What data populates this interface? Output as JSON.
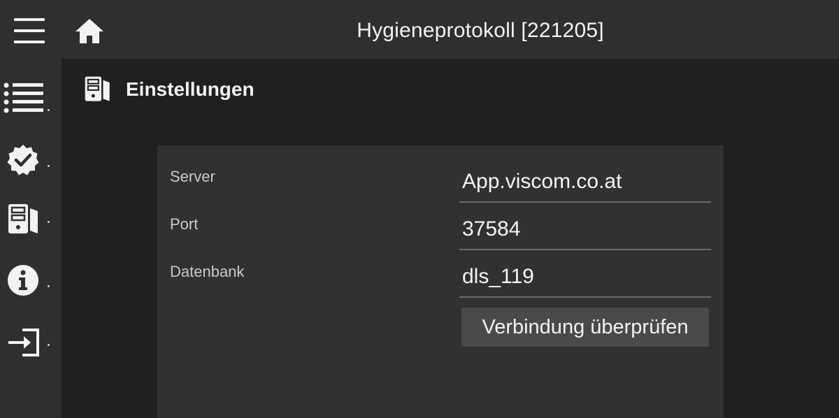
{
  "header": {
    "title": "Hygieneprotokoll [221205]",
    "menu_icon": "menu-icon",
    "home_icon": "home-icon"
  },
  "sidebar": {
    "items": [
      {
        "icon": "list-icon"
      },
      {
        "icon": "check-badge-icon"
      },
      {
        "icon": "server-icon"
      },
      {
        "icon": "info-icon"
      },
      {
        "icon": "login-icon"
      }
    ]
  },
  "page": {
    "title": "Einstellungen",
    "title_icon": "server-icon"
  },
  "settings": {
    "server": {
      "label": "Server",
      "value": "App.viscom.co.at"
    },
    "port": {
      "label": "Port",
      "value": "37584"
    },
    "database": {
      "label": "Datenbank",
      "value": "dls_119"
    },
    "check_button_label": "Verbindung überprüfen"
  },
  "colors": {
    "topbar_bg": "#2f2f2f",
    "content_bg": "#202020",
    "card_bg": "#313131",
    "button_bg": "#4a4a4a",
    "text": "#f2f2f2"
  }
}
